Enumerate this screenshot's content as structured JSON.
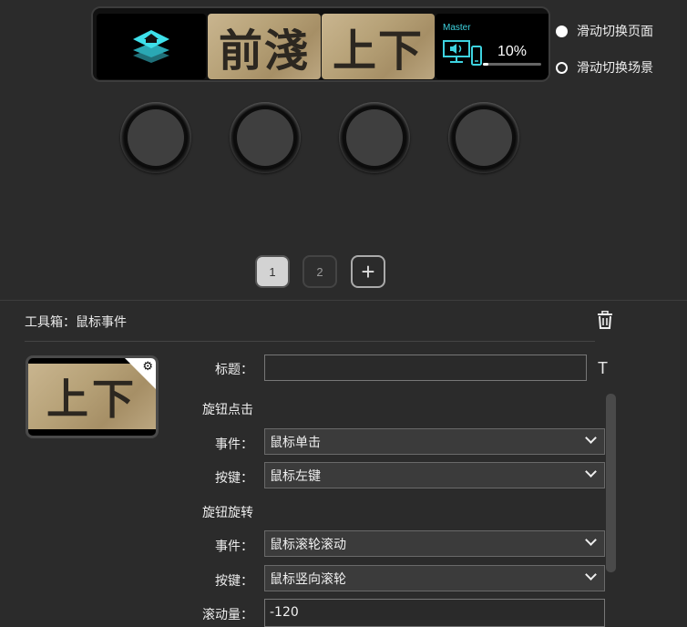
{
  "preview": {
    "tile2_text": "前淺",
    "tile3_text": "上下",
    "volume": {
      "label": "Master",
      "percent_text": "10%",
      "level": 0.1
    }
  },
  "options": [
    {
      "label": "滑动切换页面",
      "selected": true
    },
    {
      "label": "滑动切换场景",
      "selected": false
    }
  ],
  "pages": {
    "p1": "1",
    "p2": "2",
    "add": "+"
  },
  "toolbox": {
    "title": "工具箱：鼠标事件",
    "thumb_text": "上下",
    "title_label": "标题：",
    "title_value": "",
    "click_section": "旋钮点击",
    "click_event_label": "事件：",
    "click_event_value": "鼠标单击",
    "click_key_label": "按键：",
    "click_key_value": "鼠标左键",
    "rotate_section": "旋钮旋转",
    "rotate_event_label": "事件：",
    "rotate_event_value": "鼠标滚轮滚动",
    "rotate_key_label": "按键：",
    "rotate_key_value": "鼠标竖向滚轮",
    "scroll_label": "滚动量：",
    "scroll_value": "-120",
    "text_icon": "T"
  }
}
